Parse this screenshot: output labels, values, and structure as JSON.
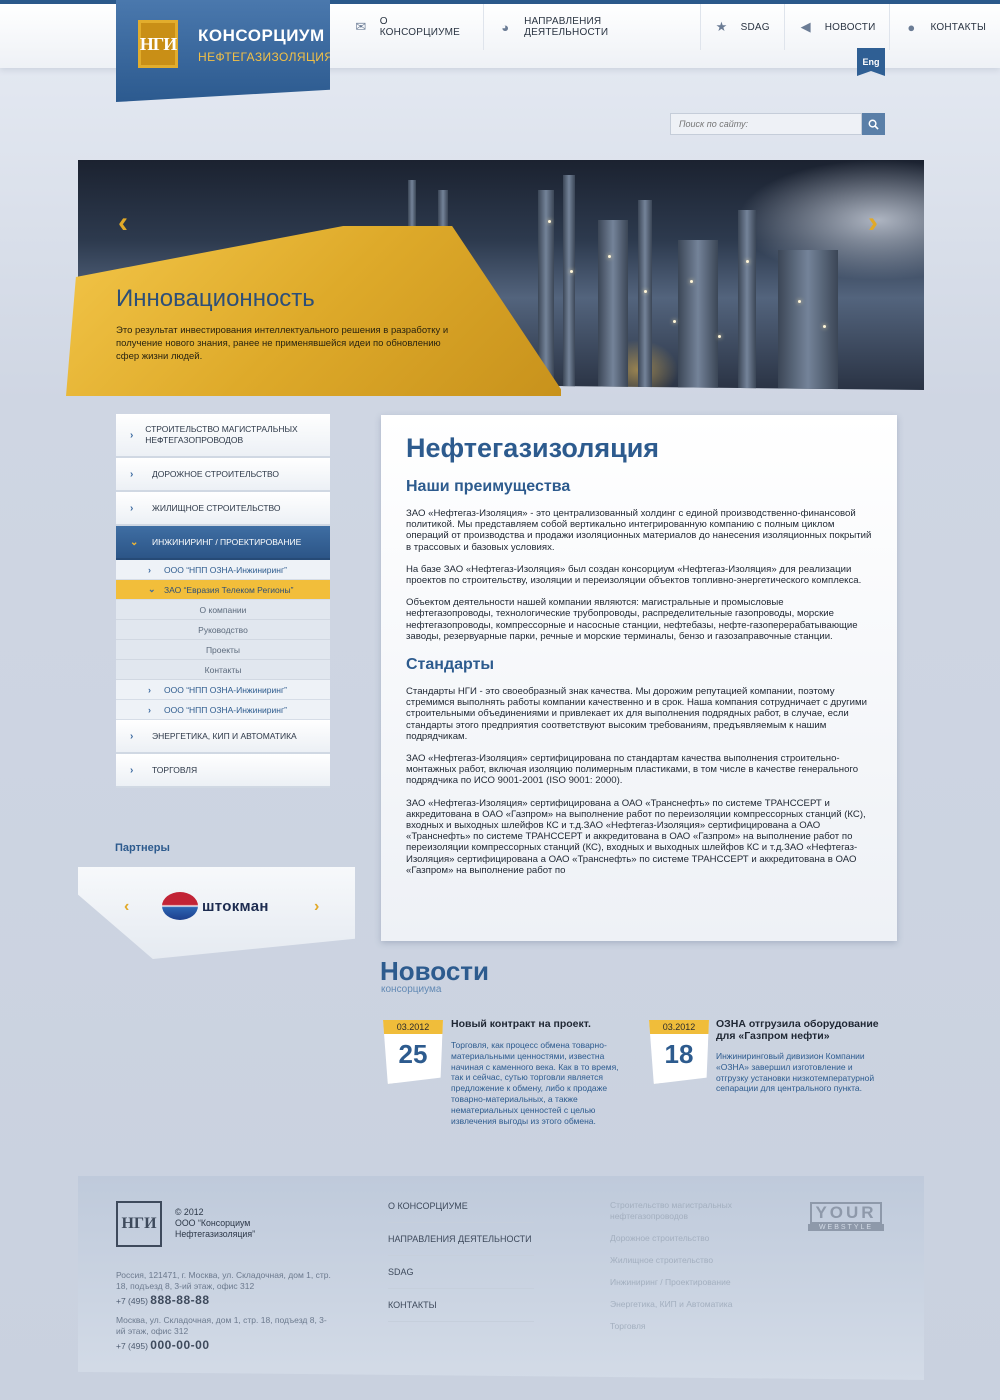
{
  "header": {
    "logo_mark": "НГИ",
    "logo_title": "КОНСОРЦИУМ",
    "logo_subtitle": "НЕФТЕГАЗИЗОЛЯЦИЯ",
    "nav": [
      {
        "label": "О КОНСОРЦИУМЕ",
        "icon": "envelope-icon"
      },
      {
        "label": "НАПРАВЛЕНИЯ ДЕЯТЕЛЬНОСТИ",
        "icon": "pie-chart-icon"
      },
      {
        "label": "SDAG",
        "icon": "star-icon"
      },
      {
        "label": "НОВОСТИ",
        "icon": "megaphone-icon"
      },
      {
        "label": "КОНТАКТЫ",
        "icon": "map-pin-icon"
      }
    ],
    "lang": "Eng",
    "search_placeholder": "Поиск по сайту:"
  },
  "slider": {
    "title": "Инновационность",
    "text": "Это результат инвестирования интеллектуального решения в разработку и получение нового знания, ранее не применявшейся идеи по обновлению сфер жизни людей.",
    "prev": "‹",
    "next": "›"
  },
  "sidebar": {
    "items": [
      {
        "label": "СТРОИТЕЛЬСТВО МАГИСТРАЛЬНЫХ НЕФТЕГАЗОПРОВОДОВ"
      },
      {
        "label": "ДОРОЖНОЕ СТРОИТЕЛЬСТВО"
      },
      {
        "label": "ЖИЛИЩНОЕ СТРОИТЕЛЬСТВО"
      },
      {
        "label": "ИНЖИНИРИНГ / ПРОЕКТИРОВАНИЕ"
      },
      {
        "label": "ЭНЕРГЕТИКА, КИП И АВТОМАТИКА"
      },
      {
        "label": "ТОРГОВЛЯ"
      }
    ],
    "sub": [
      {
        "label": "ООО “НПП ОЗНА-Инжиниринг”"
      },
      {
        "label": "ЗАО “Евразия Телеком Регионы”"
      },
      {
        "label": "ООО “НПП ОЗНА-Инжиниринг”"
      },
      {
        "label": "ООО “НПП ОЗНА-Инжиниринг”"
      }
    ],
    "subsub": [
      "О компании",
      "Руководство",
      "Проекты",
      "Контакты"
    ]
  },
  "partners": {
    "title": "Партнеры",
    "logo_name": "штокман",
    "prev": "‹",
    "next": "›"
  },
  "main": {
    "title": "Нефтегазизоляция",
    "h_advantages": "Наши преимущества",
    "p1": "ЗАО «Нефтегаз-Изоляция» - это централизованный холдинг с единой производственно-финансовой политикой. Мы представляем собой вертикально интегрированную компанию с полным циклом операций от производства и продажи изоляционных материалов до нанесения изоляционных покрытий в трассовых и базовых условиях.",
    "p2": "На базе ЗАО «Нефтегаз-Изоляция» был создан консорциум «Нефтегаз-Изоляция» для реализации проектов по строительству, изоляции и переизоляции объектов топливно-энергетического комплекса.",
    "p3": "Объектом деятельности нашей компании являются: магистральные и промысловые нефтегазопроводы, технологические трубопроводы, распределительные газопроводы, морские нефтегазопроводы, компрессорные и насосные станции, нефтебазы, нефте-газоперерабатывающие заводы, резервуарные парки, речные и морские терминалы, бензо и газозаправочные станции.",
    "h_standards": "Стандарты",
    "p4": "Стандарты НГИ - это своеобразный знак качества. Мы дорожим репутацией компании, поэтому стремимся выполнять работы компании качественно и в срок. Наша компания сотрудничает с другими строительными объединениями и привлекает их для выполнения подрядных работ, в случае, если стандарты этого предприятия соответствуют высоким требованиям, предъявляемым к нашим подрядчикам.",
    "p5": "ЗАО «Нефтегаз-Изоляция» сертифицирована по стандартам качества выполнения строительно-монтажных работ, включая изоляцию полимерным пластиками, в том числе в качестве генерального подрядчика по ИСО 9001-2001 (ISO 9001: 2000).",
    "p6": "ЗАО «Нефтегаз-Изоляция» сертифицирована а ОАО «Транснефть» по системе ТРАНССЕРТ и аккредитована в ОАО «Газпром» на выполнение работ по переизоляции компрессорных станций (КС), входных и выходных шлейфов КС и т.д.ЗАО «Нефтегаз-Изоляция» сертифицирована а ОАО «Транснефть» по системе ТРАНССЕРТ и аккредитована в ОАО «Газпром» на выполнение работ по переизоляции компрессорных станций (КС), входных и выходных шлейфов КС и т.д.ЗАО «Нефтегаз-Изоляция» сертифицирована а ОАО «Транснефть» по системе ТРАНССЕРТ и аккредитована в ОАО «Газпром» на выполнение работ по"
  },
  "news": {
    "title": "Новости",
    "subtitle": "консорциума",
    "items": [
      {
        "month": "03.2012",
        "day": "25",
        "head": "Новый контракт на проект.",
        "text": "Торговля, как процесс обмена товарно-материальными ценностями, известна начиная с каменного века. Как в то время, так и сейчас, сутью торговли является предложение к обмену, либо к продаже товарно-материальных, а также нематериальных ценностей с целью извлечения выгоды из этого обмена."
      },
      {
        "month": "03.2012",
        "day": "18",
        "head": "ОЗНА отгрузила оборудование для «Газпром нефти»",
        "text": "Инжиниринговый дивизион Компании «ОЗНА» завершил изготовление и отгрузку установки низкотемпературной сепарации для центрального пункта."
      }
    ]
  },
  "footer": {
    "logo_mark": "НГИ",
    "copyright": "© 2012",
    "company": "ООО “Консорциум",
    "company2": "Нефтегазизоляция”",
    "addr1": "Россия, 121471, г. Москва, ул. Складочная, дом 1, стр. 18, подъезд 8, 3-ий этаж, офис 312",
    "phone1_code": "+7 (495)",
    "phone1": "888-88-88",
    "addr2": "Москва, ул. Складочная, дом 1, стр. 18, подъезд 8, 3-ий этаж, офис 312",
    "phone2_code": "+7 (495)",
    "phone2": "000-00-00",
    "nav": [
      "О КОНСОРЦИУМЕ",
      "НАПРАВЛЕНИЯ ДЕЯТЕЛЬНОСТИ",
      "SDAG",
      "КОНТАКТЫ"
    ],
    "links": [
      "Строительство магистральных нефтегазопроводов",
      "Дорожное строительство",
      "Жилищное строительство",
      "Инжиниринг / Проектирование",
      "Энергетика, КИП и Автоматика",
      "Торговля"
    ],
    "badge_big": "YOUR",
    "badge_small": "WEBSTYLE"
  }
}
